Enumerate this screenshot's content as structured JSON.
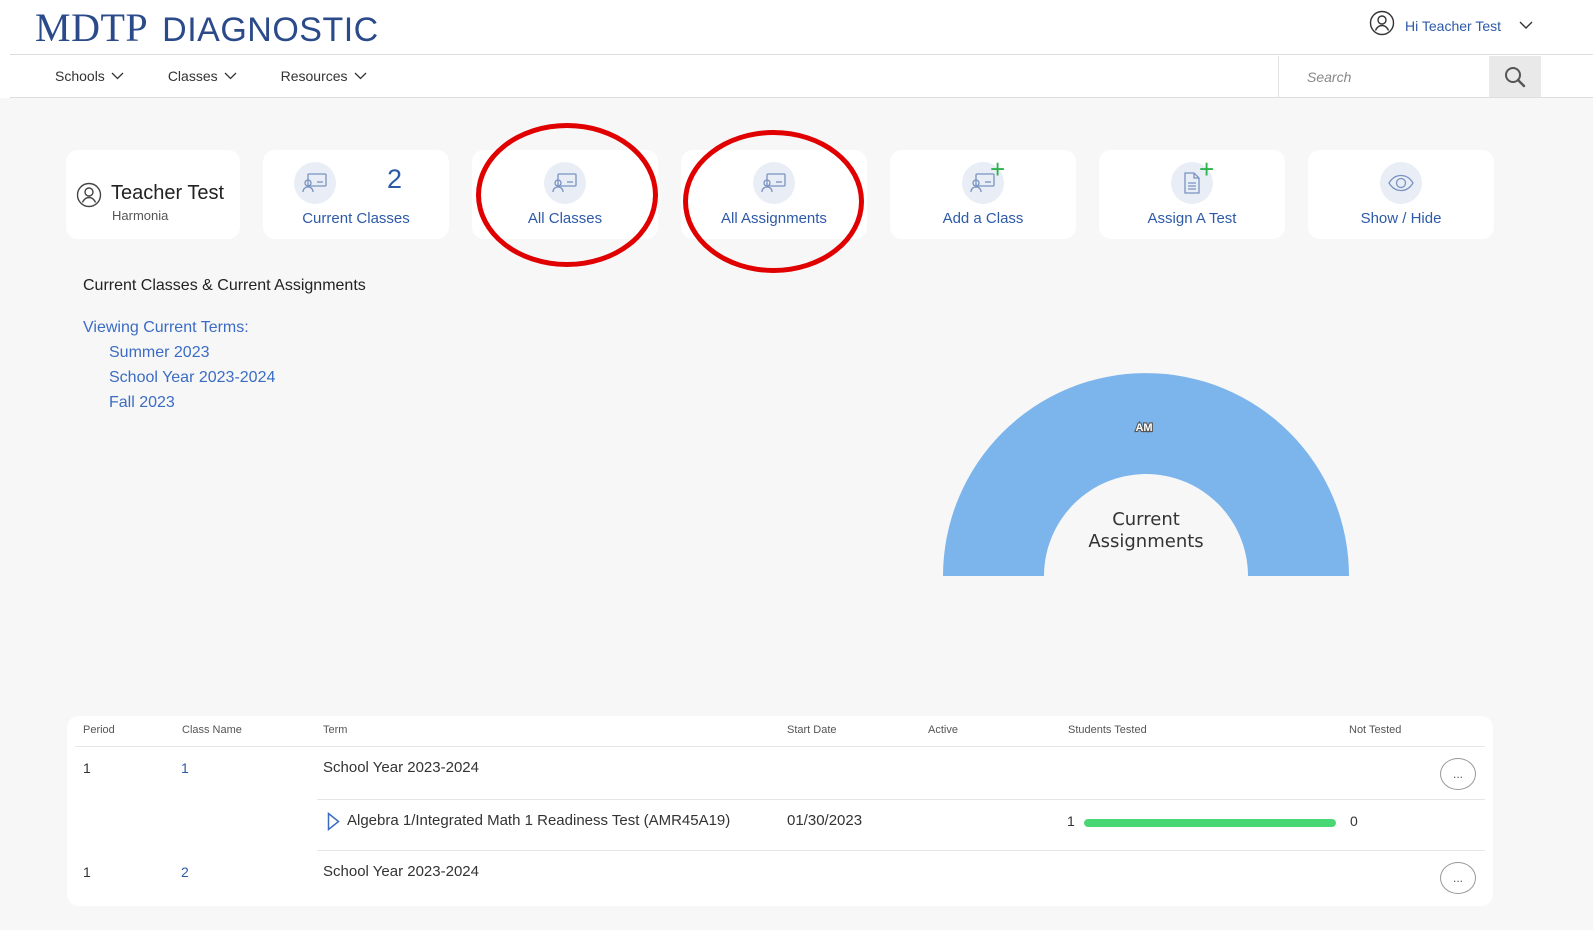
{
  "brand": {
    "part1": "MDTP",
    "part2": "DIAGNOSTIC"
  },
  "user": {
    "greeting": "Hi Teacher Test"
  },
  "nav": {
    "items": [
      "Schools",
      "Classes",
      "Resources"
    ]
  },
  "search": {
    "placeholder": "Search"
  },
  "profile": {
    "name": "Teacher Test",
    "org": "Harmonia"
  },
  "cards": {
    "current_classes": {
      "label": "Current Classes",
      "count": "2"
    },
    "all_classes": {
      "label": "All Classes"
    },
    "all_assignments": {
      "label": "All Assignments"
    },
    "add_class": {
      "label": "Add a Class"
    },
    "assign_test": {
      "label": "Assign A Test"
    },
    "show_hide": {
      "label": "Show / Hide"
    }
  },
  "section": {
    "title": "Current Classes & Current Assignments",
    "terms_heading": "Viewing Current Terms:",
    "terms": [
      "Summer 2023",
      "School Year 2023-2024",
      "Fall 2023"
    ]
  },
  "gauge": {
    "center_line1": "Current",
    "center_line2": "Assignments",
    "color": "#7cb5ec"
  },
  "chart_data": {
    "type": "pie",
    "categories": [
      "AM"
    ],
    "values": [
      1
    ],
    "title": "",
    "center_text": "Current Assignments"
  },
  "table": {
    "headers": [
      "Period",
      "Class Name",
      "Term",
      "Start Date",
      "Active",
      "Students Tested",
      "Not Tested"
    ],
    "rows": [
      {
        "period": "1",
        "class_name": "1",
        "term": "School Year 2023-2024"
      },
      {
        "period": "1",
        "class_name": "2",
        "term": "School Year 2023-2024"
      }
    ],
    "assignment": {
      "name": "Algebra 1/Integrated Math 1 Readiness Test (AMR45A19)",
      "start_date": "01/30/2023",
      "students_tested": "1",
      "not_tested": "0",
      "tested_fraction": 1.0
    },
    "more_label": "..."
  },
  "colors": {
    "accent": "#2d5aa8",
    "annotation": "#e00000",
    "progress": "#48d774"
  }
}
